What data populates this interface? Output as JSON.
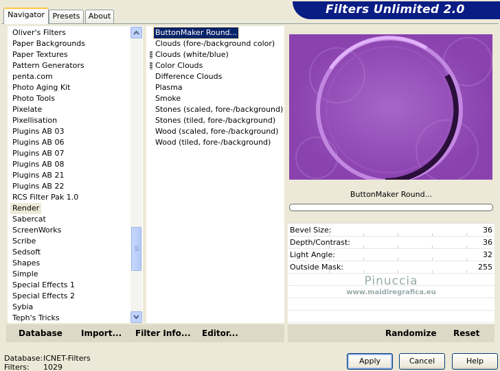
{
  "tabs": [
    "Navigator",
    "Presets",
    "About"
  ],
  "app_title": "Filters Unlimited 2.0",
  "categories": [
    "Oliver's Filters",
    "Paper Backgrounds",
    "Paper Textures",
    "Pattern Generators",
    "penta.com",
    "Photo Aging Kit",
    "Photo Tools",
    "Pixelate",
    "Pixellisation",
    "Plugins AB 03",
    "Plugins AB 06",
    "Plugins AB 07",
    "Plugins AB 08",
    "Plugins AB 21",
    "Plugins AB 22",
    "RCS Filter Pak 1.0",
    "Render",
    "Sabercat",
    "ScreenWorks",
    "Scribe",
    "Sedsoft",
    "Shapes",
    "Simple",
    "Special Effects 1",
    "Special Effects 2",
    "Sybia",
    "Teph's Tricks"
  ],
  "selected_category": "Render",
  "filters": [
    "ButtonMaker Round...",
    "Clouds (fore-/background color)",
    "Clouds (white/blue)",
    "Color Clouds",
    "Difference Clouds",
    "Plasma",
    "Smoke",
    "Stones (scaled, fore-/background)",
    "Stones (tiled, fore-/background)",
    "Wood (scaled, fore-/background)",
    "Wood (tiled, fore-/background)"
  ],
  "selected_filter": "ButtonMaker Round...",
  "filter_name_display": "ButtonMaker Round...",
  "params": [
    {
      "label": "Bevel Size:",
      "value": "36"
    },
    {
      "label": "Depth/Contrast:",
      "value": "36"
    },
    {
      "label": "Light Angle:",
      "value": "32"
    },
    {
      "label": "Outside Mask:",
      "value": "255"
    }
  ],
  "watermark": {
    "name": "Pinuccia",
    "url": "www.maidiregrafica.eu"
  },
  "toolbar": {
    "database": "Database",
    "import": "Import...",
    "filter_info": "Filter Info...",
    "editor": "Editor...",
    "randomize": "Randomize",
    "reset": "Reset"
  },
  "status": {
    "database_label": "Database:",
    "database_value": "ICNET-Filters",
    "filters_label": "Filters:",
    "filters_value": "1029"
  },
  "buttons": {
    "apply": "Apply",
    "cancel": "Cancel",
    "help": "Help"
  },
  "colors": {
    "banner": "#0a1d84",
    "preview": "#8f46b3",
    "selection": "#0a246a"
  }
}
